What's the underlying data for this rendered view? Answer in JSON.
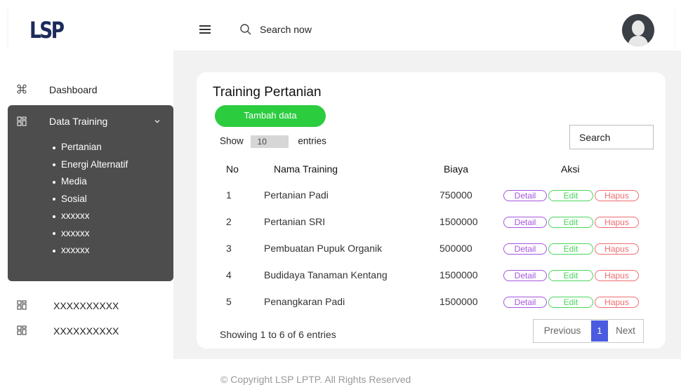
{
  "header": {
    "logo": "LSP",
    "search_text": "Search now"
  },
  "sidebar": {
    "dashboard_label": "Dashboard",
    "data_training": {
      "label": "Data Training",
      "items": [
        "Pertanian",
        "Energi Alternatif",
        "Media",
        "Sosial",
        "xxxxxx",
        "xxxxxx",
        "xxxxxx"
      ]
    },
    "extra_items": [
      "XXXXXXXXXX",
      "XXXXXXXXXX"
    ]
  },
  "main": {
    "title": "Training Pertanian",
    "add_button": "Tambah data",
    "show": {
      "prefix": "Show",
      "value": "10",
      "suffix": "entries"
    },
    "search_label": "Search",
    "table": {
      "headers": {
        "no": "No",
        "name": "Nama Training",
        "biaya": "Biaya",
        "aksi": "Aksi"
      },
      "rows": [
        {
          "no": "1",
          "name": "Pertanian Padi",
          "biaya": "750000"
        },
        {
          "no": "2",
          "name": "Pertanian SRI",
          "biaya": "1500000"
        },
        {
          "no": "3",
          "name": "Pembuatan Pupuk Organik",
          "biaya": "500000"
        },
        {
          "no": "4",
          "name": "Budidaya Tanaman Kentang",
          "biaya": "1500000"
        },
        {
          "no": "5",
          "name": "Penangkaran Padi",
          "biaya": "1500000"
        }
      ],
      "actions": {
        "detail": "Detail",
        "edit": "Edit",
        "hapus": "Hapus"
      }
    },
    "showing_text": "Showing 1 to 6 of 6 entries",
    "pagination": {
      "previous": "Previous",
      "current": "1",
      "next": "Next"
    }
  },
  "footer": {
    "copyright": "© Copyright LSP LPTP. All Rights Reserved"
  },
  "colors": {
    "sidebar_active": "#4d4d4d",
    "add_button": "#2ccc3f",
    "detail": "#a555e0",
    "edit": "#48d65a",
    "hapus": "#ee6c70",
    "page_active": "#4a5be0"
  }
}
